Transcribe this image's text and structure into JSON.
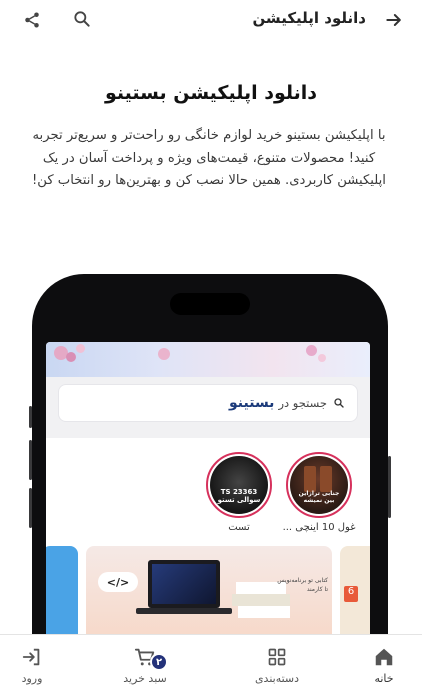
{
  "topbar": {
    "title": "دانلود اپلیکیشن"
  },
  "headline": "دانلود اپلیکیشن بستینو",
  "description": "با اپلیکیشن بستینو خرید لوازم خانگی رو راحت‌تر و سریع‌تر تجربه کنید! محصولات متنوع، قیمت‌های ویژه و پرداخت آسان در یک اپلیکیشن کاربردی. همین حالا نصب کن و بهترین‌ها رو انتخاب کن!",
  "app_preview": {
    "search_text": "جستجو در",
    "brand": "بستینو",
    "stories": [
      {
        "label": "غول 10 اینچی ...",
        "image_text": "جنابی ترازاین\nبین نمیشه"
      },
      {
        "label": "تست",
        "image_text": "TS 23363\nسوالی تستو"
      }
    ],
    "promo_text": "کتابی تو برنامه‌نویس\nتا کارمند"
  },
  "bottom_nav": {
    "items": [
      {
        "label": "خانه",
        "icon": "home-icon"
      },
      {
        "label": "دسته‌بندی",
        "icon": "grid-icon"
      },
      {
        "label": "سبد خرید",
        "icon": "cart-icon",
        "badge": "۲"
      },
      {
        "label": "ورود",
        "icon": "login-icon"
      }
    ]
  },
  "colors": {
    "accent": "#24327a",
    "story_ring": "#d6315c",
    "text_primary": "#111111"
  }
}
